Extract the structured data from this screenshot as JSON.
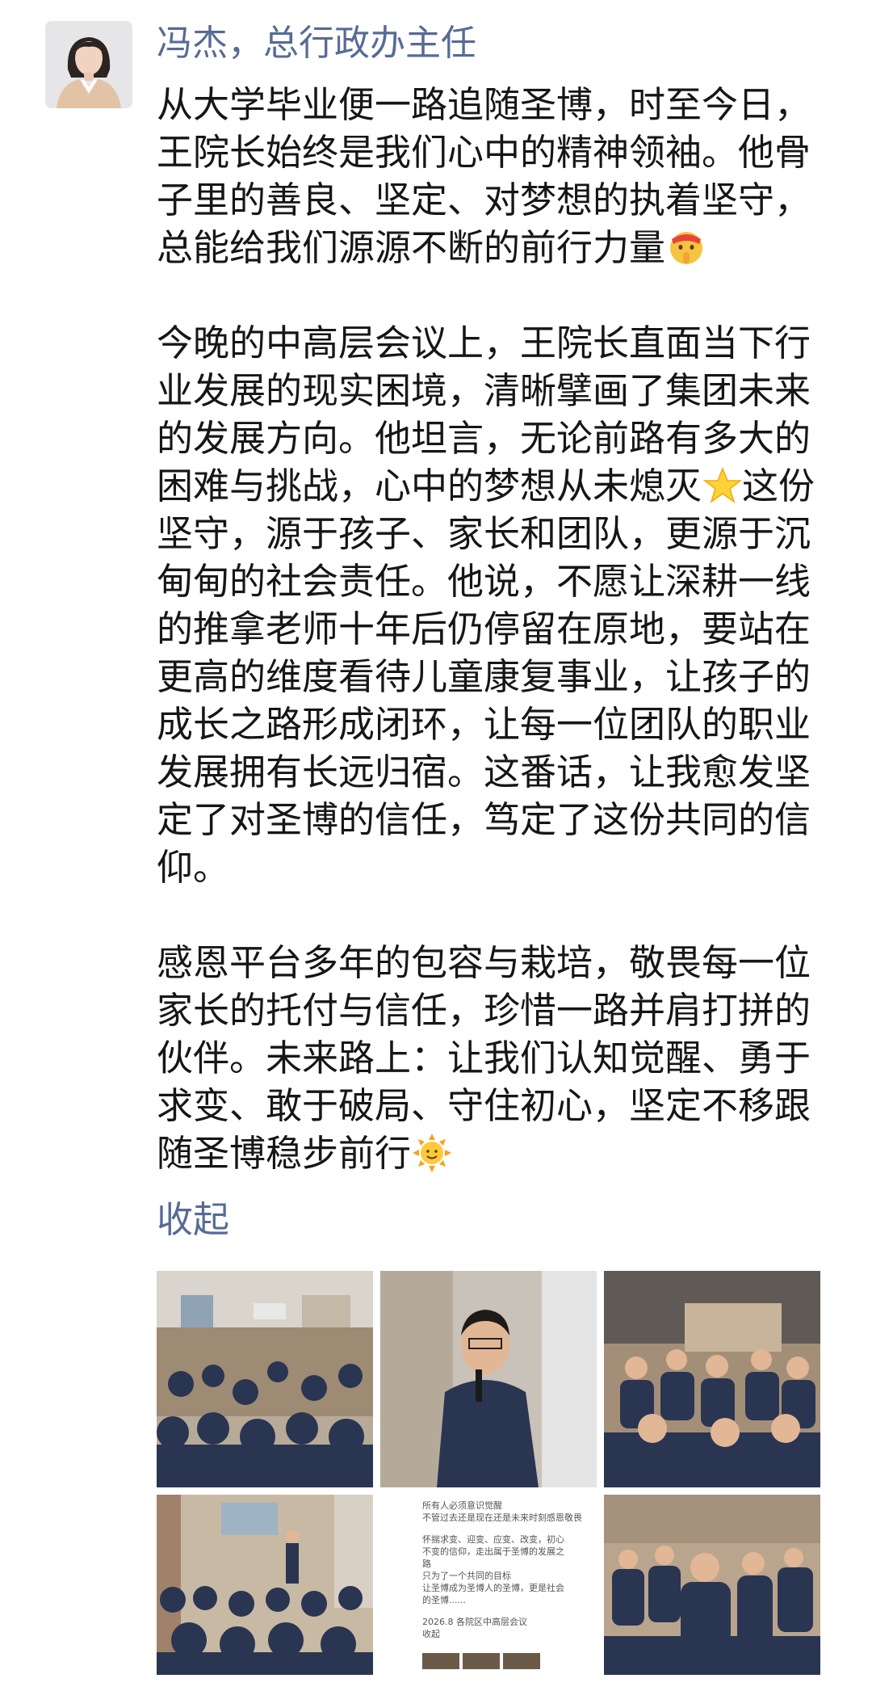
{
  "post": {
    "author": "冯杰，总行政办主任",
    "paragraphs": [
      "从大学毕业便一路追随圣博，时至今日，王院长始终是我们心中的精神领袖。他骨子里的善良、坚定、对梦想的执着坚守，总能给我们源源不断的前行力量",
      "今晚的中高层会议上，王院长直面当下行业发展的现实困境，清晰擘画了集团未来的发展方向。他坦言，无论前路有多大的困难与挑战，心中的梦想从未熄灭",
      "这份坚守，源于孩子、家长和团队，更源于沉甸甸的社会责任。他说，不愿让深耕一线的推拿老师十年后仍停留在原地，要站在更高的维度看待儿童康复事业，让孩子的成长之路形成闭环，让每一位团队的职业发展拥有长远归宿。这番话，让我愈发坚定了对圣博的信任，笃定了这份共同的信仰。",
      "感恩平台多年的包容与栽培，敬畏每一位家长的托付与信任，珍惜一路并肩打拼的伙伴。未来路上：让我们认知觉醒、勇于求变、敢于破局、守住初心，坚定不移跟随圣博稳步前行"
    ],
    "emojis": [
      "shushing-face-emoji",
      "star-emoji",
      "sun-emoji"
    ],
    "collapse_label": "收起"
  },
  "poster": {
    "lines": [
      "所有人必须意识觉醒",
      "不管过去还是现在还是未来时刻感恩敬畏",
      "怀揣求变、迎变、应变、改变，初心",
      "不变的信仰，走出属于圣博的发展之",
      "路",
      "只为了一个共同的目标",
      "让圣博成为圣博人的圣博，更是社会",
      "的圣博......"
    ],
    "footer": "2026.8 各院区中高层会议",
    "footer_sub": "收起"
  },
  "colors": {
    "link": "#576b95",
    "text": "#161616",
    "uniform": "#2a3552"
  }
}
